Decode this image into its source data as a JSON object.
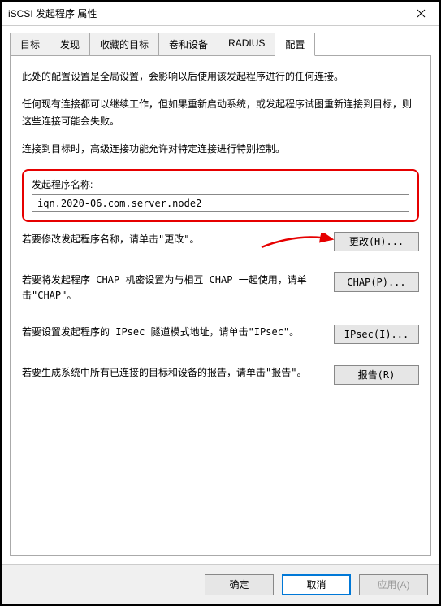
{
  "window": {
    "title": "iSCSI 发起程序 属性"
  },
  "tabs": {
    "target": "目标",
    "discover": "发现",
    "favorites": "收藏的目标",
    "volumes": "卷和设备",
    "radius": "RADIUS",
    "config": "配置"
  },
  "content": {
    "intro1": "此处的配置设置是全局设置，会影响以后使用该发起程序进行的任何连接。",
    "intro2": "任何现有连接都可以继续工作，但如果重新启动系统，或发起程序试图重新连接到目标，则这些连接可能会失败。",
    "intro3": "连接到目标时，高级连接功能允许对特定连接进行特别控制。",
    "initiator_label": "发起程序名称:",
    "initiator_value": "iqn.2020-06.com.server.node2",
    "change_text": "若要修改发起程序名称，请单击\"更改\"。",
    "change_btn": "更改(H)...",
    "chap_text": "若要将发起程序 CHAP 机密设置为与相互 CHAP 一起使用，请单击\"CHAP\"。",
    "chap_btn": "CHAP(P)...",
    "ipsec_text": "若要设置发起程序的 IPsec 隧道模式地址，请单击\"IPsec\"。",
    "ipsec_btn": "IPsec(I)...",
    "report_text": "若要生成系统中所有已连接的目标和设备的报告，请单击\"报告\"。",
    "report_btn": "报告(R)"
  },
  "buttons": {
    "ok": "确定",
    "cancel": "取消",
    "apply": "应用(A)"
  }
}
